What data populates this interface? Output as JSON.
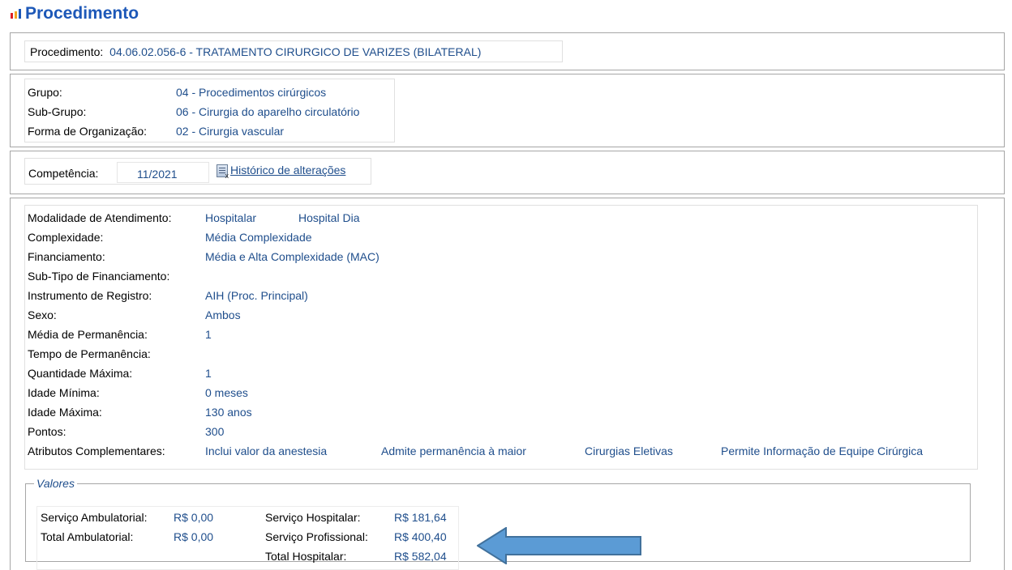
{
  "page_title": "Procedimento",
  "logo_colors": [
    "#e01f26",
    "#f5a623",
    "#1d58b8"
  ],
  "procedimento": {
    "label": "Procedimento:",
    "value": "04.06.02.056-6 - TRATAMENTO CIRURGICO DE VARIZES (BILATERAL)"
  },
  "classificacao": {
    "grupo_label": "Grupo:",
    "grupo_value": "04 - Procedimentos cirúrgicos",
    "subgrupo_label": "Sub-Grupo:",
    "subgrupo_value": "06 - Cirurgia do aparelho circulatório",
    "forma_label": "Forma de Organização:",
    "forma_value": "02 - Cirurgia vascular"
  },
  "competencia": {
    "label": "Competência:",
    "value": "11/2021",
    "historico_link": "Histórico de alterações",
    "icon": "document-icon"
  },
  "detalhes": {
    "modalidade_label": "Modalidade de Atendimento:",
    "modalidade_1": "Hospitalar",
    "modalidade_2": "Hospital Dia",
    "complexidade_label": "Complexidade:",
    "complexidade_value": "Média Complexidade",
    "financiamento_label": "Financiamento:",
    "financiamento_value": "Média e Alta Complexidade (MAC)",
    "subtipo_label": "Sub-Tipo de Financiamento:",
    "instrumento_label": "Instrumento de Registro:",
    "instrumento_value": "AIH (Proc. Principal)",
    "sexo_label": "Sexo:",
    "sexo_value": "Ambos",
    "media_perm_label": "Média de Permanência:",
    "media_perm_value": "1",
    "tempo_perm_label": "Tempo de Permanência:",
    "qtd_max_label": "Quantidade Máxima:",
    "qtd_max_value": "1",
    "idade_min_label": "Idade Mínima:",
    "idade_min_value": "0 meses",
    "idade_max_label": "Idade Máxima:",
    "idade_max_value": "130 anos",
    "pontos_label": "Pontos:",
    "pontos_value": "300",
    "atributos_label": "Atributos Complementares:",
    "atributos": [
      "Inclui valor da anestesia",
      "Admite permanência à maior",
      "Cirurgias Eletivas",
      "Permite Informação de Equipe Cirúrgica"
    ]
  },
  "valores": {
    "legend": "Valores",
    "serv_amb_label": "Serviço Ambulatorial:",
    "serv_amb_value": "R$ 0,00",
    "total_amb_label": "Total Ambulatorial:",
    "total_amb_value": "R$ 0,00",
    "serv_hosp_label": "Serviço Hospitalar:",
    "serv_hosp_value": "R$ 181,64",
    "serv_prof_label": "Serviço Profissional:",
    "serv_prof_value": "R$ 400,40",
    "total_hosp_label": "Total Hospitalar:",
    "total_hosp_value": "R$ 582,04"
  },
  "arrow_color": "#5b9bd5"
}
